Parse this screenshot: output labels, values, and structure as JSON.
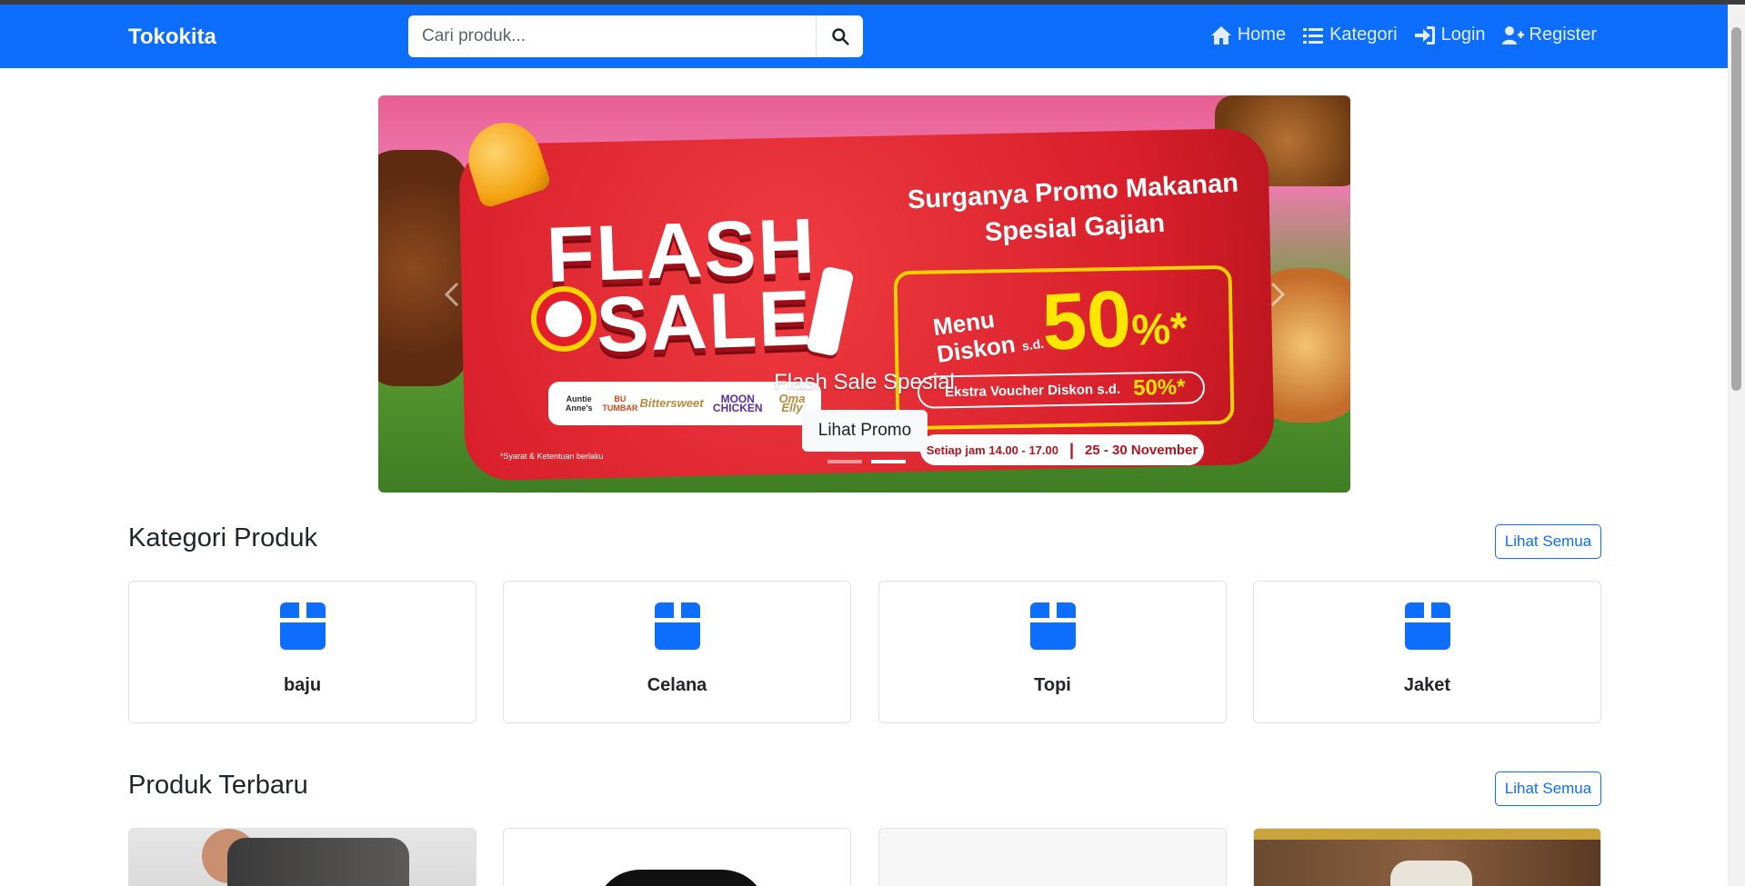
{
  "navbar": {
    "brand": "Tokokita",
    "search_placeholder": "Cari produk...",
    "links": [
      {
        "label": "Home",
        "icon": "home-icon"
      },
      {
        "label": "Kategori",
        "icon": "list-icon"
      },
      {
        "label": "Login",
        "icon": "login-icon"
      },
      {
        "label": "Register",
        "icon": "user-plus-icon"
      }
    ]
  },
  "carousel": {
    "banner": {
      "flash": "FLASH",
      "sale": "SALE",
      "headline": "Surganya Promo Makanan Spesial Gajian",
      "menu_diskon_line1": "Menu",
      "menu_diskon_line2": "Diskon",
      "sd": "s.d.",
      "big_percent": "50",
      "percent_sign": "%*",
      "ekstra_text": "Ekstra Voucher Diskon s.d.",
      "ekstra_value": "50%*",
      "time_text": "Setiap jam 14.00 - 17.00",
      "date_text": "25 - 30 November",
      "terms": "*Syarat & Ketentuan berlaku",
      "logos": [
        "Auntie Anne's",
        "BU TUMBAR",
        "Bittersweet",
        "MOON CHICKEN",
        "Oma Elly"
      ]
    },
    "caption_title": "Flash Sale Spesial",
    "caption_button": "Lihat Promo",
    "active_slide": 2,
    "slide_count": 2
  },
  "kategori": {
    "title": "Kategori Produk",
    "see_all": "Lihat Semua",
    "items": [
      {
        "label": "baju"
      },
      {
        "label": "Celana"
      },
      {
        "label": "Topi"
      },
      {
        "label": "Jaket"
      }
    ]
  },
  "produk": {
    "title": "Produk Terbaru",
    "see_all": "Lihat Semua"
  },
  "colors": {
    "primary": "#0d6efd",
    "banner_red": "#d81f2b",
    "banner_yellow": "#ffe600"
  }
}
